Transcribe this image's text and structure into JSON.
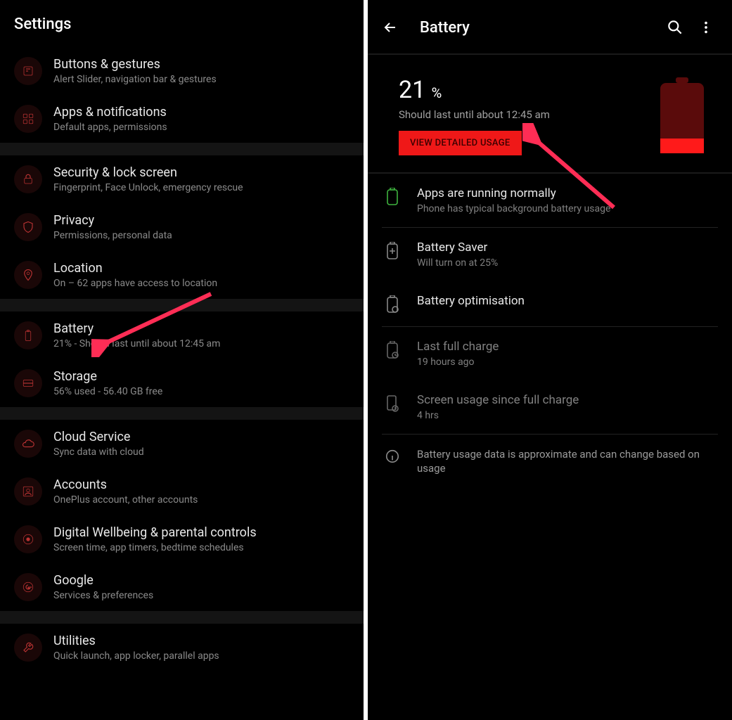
{
  "left": {
    "header": "Settings",
    "items": [
      {
        "title": "Buttons & gestures",
        "sub": "Alert Slider, navigation bar & gestures"
      },
      {
        "title": "Apps & notifications",
        "sub": "Default apps, permissions"
      },
      {
        "title": "Security & lock screen",
        "sub": "Fingerprint, Face Unlock, emergency rescue"
      },
      {
        "title": "Privacy",
        "sub": "Permissions, personal data"
      },
      {
        "title": "Location",
        "sub": "On – 62 apps have access to location"
      },
      {
        "title": "Battery",
        "sub": "21% - Should last until about 12:45 am"
      },
      {
        "title": "Storage",
        "sub": "56% used - 56.40 GB free"
      },
      {
        "title": "Cloud Service",
        "sub": "Sync data with cloud"
      },
      {
        "title": "Accounts",
        "sub": "OnePlus account, other accounts"
      },
      {
        "title": "Digital Wellbeing & parental controls",
        "sub": "Screen time, app timers, bedtime schedules"
      },
      {
        "title": "Google",
        "sub": "Services & preferences"
      },
      {
        "title": "Utilities",
        "sub": "Quick launch, app locker, parallel apps"
      }
    ]
  },
  "right": {
    "header": "Battery",
    "percent": "21",
    "percent_symbol": "%",
    "forecast": "Should last until about 12:45 am",
    "button": "VIEW DETAILED USAGE",
    "items": {
      "apps_title": "Apps are running normally",
      "apps_sub": "Phone has typical background battery usage",
      "saver_title": "Battery Saver",
      "saver_sub": "Will turn on at 25%",
      "optim_title": "Battery optimisation",
      "last_title": "Last full charge",
      "last_sub": "19 hours ago",
      "screen_title": "Screen usage since full charge",
      "screen_sub": "4 hrs",
      "note": "Battery usage data is approximate and can change based on usage"
    }
  }
}
